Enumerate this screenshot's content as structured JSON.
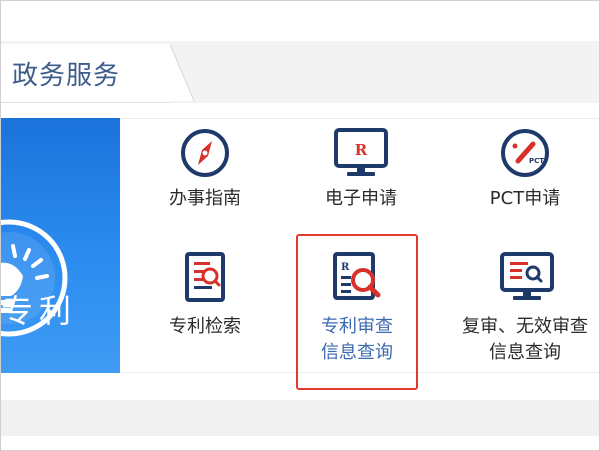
{
  "section": {
    "title": "政务服务"
  },
  "banner": {
    "text": "专利"
  },
  "services": [
    {
      "label": "办事指南",
      "icon": "compass-icon"
    },
    {
      "label": "电子申请",
      "icon": "monitor-r-icon"
    },
    {
      "label": "PCT申请",
      "icon": "pct-pen-icon"
    },
    {
      "label": "专利检索",
      "icon": "document-search-icon"
    },
    {
      "label_line1": "专利审查",
      "label_line2": "信息查询",
      "icon": "r-magnifier-icon"
    },
    {
      "label_line1": "复审、无效审查",
      "label_line2": "信息查询",
      "icon": "monitor-search-icon"
    }
  ],
  "colors": {
    "icon_navy": "#1e3a6b",
    "icon_red": "#d6312b",
    "highlight": "#e03a2c",
    "banner_blue": "#2c8cf0"
  }
}
